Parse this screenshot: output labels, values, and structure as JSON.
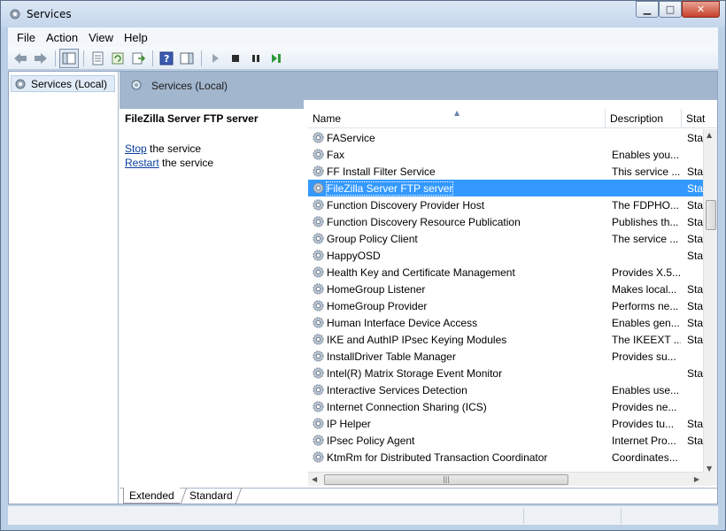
{
  "window": {
    "title": "Services",
    "controls": [
      "minimize",
      "maximize",
      "close"
    ]
  },
  "menu": [
    "File",
    "Action",
    "View",
    "Help"
  ],
  "tree": {
    "root": "Services (Local)"
  },
  "pane": {
    "header": "Services (Local)"
  },
  "details": {
    "service_name": "FileZilla Server FTP server",
    "stop_link": "Stop",
    "stop_suffix": " the service",
    "restart_link": "Restart",
    "restart_suffix": " the service"
  },
  "columns": [
    "Name",
    "Description",
    "Stat"
  ],
  "services": [
    {
      "name": "FAService",
      "description": "",
      "status": "Star"
    },
    {
      "name": "Fax",
      "description": "Enables you...",
      "status": ""
    },
    {
      "name": "FF Install Filter Service",
      "description": "This service ...",
      "status": "Star"
    },
    {
      "name": "FileZilla Server FTP server",
      "description": "",
      "status": "Star",
      "selected": true
    },
    {
      "name": "Function Discovery Provider Host",
      "description": "The FDPHO...",
      "status": "Star"
    },
    {
      "name": "Function Discovery Resource Publication",
      "description": "Publishes th...",
      "status": "Star"
    },
    {
      "name": "Group Policy Client",
      "description": "The service ...",
      "status": "Star"
    },
    {
      "name": "HappyOSD",
      "description": "",
      "status": "Star"
    },
    {
      "name": "Health Key and Certificate Management",
      "description": "Provides X.5...",
      "status": ""
    },
    {
      "name": "HomeGroup Listener",
      "description": "Makes local...",
      "status": "Star"
    },
    {
      "name": "HomeGroup Provider",
      "description": "Performs ne...",
      "status": "Star"
    },
    {
      "name": "Human Interface Device Access",
      "description": "Enables gen...",
      "status": "Star"
    },
    {
      "name": "IKE and AuthIP IPsec Keying Modules",
      "description": "The IKEEXT ...",
      "status": "Star"
    },
    {
      "name": "InstallDriver Table Manager",
      "description": "Provides su...",
      "status": ""
    },
    {
      "name": "Intel(R) Matrix Storage Event Monitor",
      "description": "",
      "status": "Star"
    },
    {
      "name": "Interactive Services Detection",
      "description": "Enables use...",
      "status": ""
    },
    {
      "name": "Internet Connection Sharing (ICS)",
      "description": "Provides ne...",
      "status": ""
    },
    {
      "name": "IP Helper",
      "description": "Provides tu...",
      "status": "Star"
    },
    {
      "name": "IPsec Policy Agent",
      "description": "Internet Pro...",
      "status": "Star"
    },
    {
      "name": "KtmRm for Distributed Transaction Coordinator",
      "description": "Coordinates...",
      "status": ""
    }
  ],
  "tabs": [
    "Extended",
    "Standard"
  ],
  "colors": {
    "selection": "#3399ff",
    "header_band": "#a2b6ce",
    "link": "#0b3e9e"
  }
}
